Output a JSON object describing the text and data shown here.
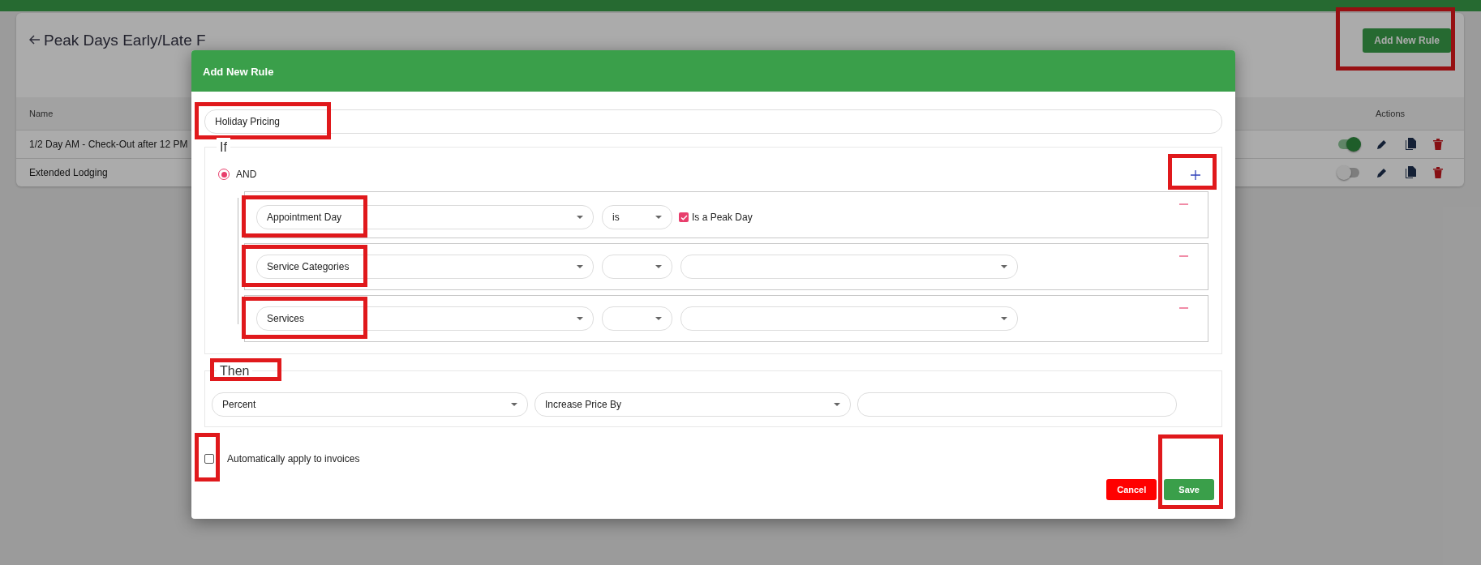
{
  "page": {
    "title": "Peak Days Early/Late F",
    "add_button": {
      "label": "Add New Rule",
      "highlighted": true
    },
    "table": {
      "columns": [
        "Name",
        "Actions"
      ],
      "rows": [
        {
          "name": "1/2 Day AM - Check-Out after 12 PM",
          "enabled": true
        },
        {
          "name": "Extended Lodging",
          "enabled": false
        }
      ]
    }
  },
  "modal": {
    "title": "Add New Rule",
    "name_field": {
      "value": "Holiday Pricing",
      "highlighted": true
    },
    "if_section": {
      "legend": "If",
      "operator": {
        "label": "AND",
        "selected": true
      },
      "add_highlighted": true,
      "conditions": [
        {
          "kind": "checkbox",
          "field": "Appointment Day",
          "operator": "is",
          "check_label": "Is a Peak Day",
          "checked": true,
          "highlighted": true
        },
        {
          "kind": "select",
          "field": "Service Categories",
          "highlighted": true
        },
        {
          "kind": "select",
          "field": "Services",
          "highlighted": true
        }
      ]
    },
    "then_section": {
      "legend": "Then",
      "highlighted": true,
      "type": "Percent",
      "action": "Increase Price By"
    },
    "auto_apply": {
      "label": "Automatically apply to invoices",
      "checked": false,
      "highlighted": true
    },
    "buttons": [
      {
        "kind": "cancel",
        "label": "Cancel",
        "highlighted": false
      },
      {
        "kind": "save",
        "label": "Save",
        "highlighted": true
      }
    ]
  }
}
